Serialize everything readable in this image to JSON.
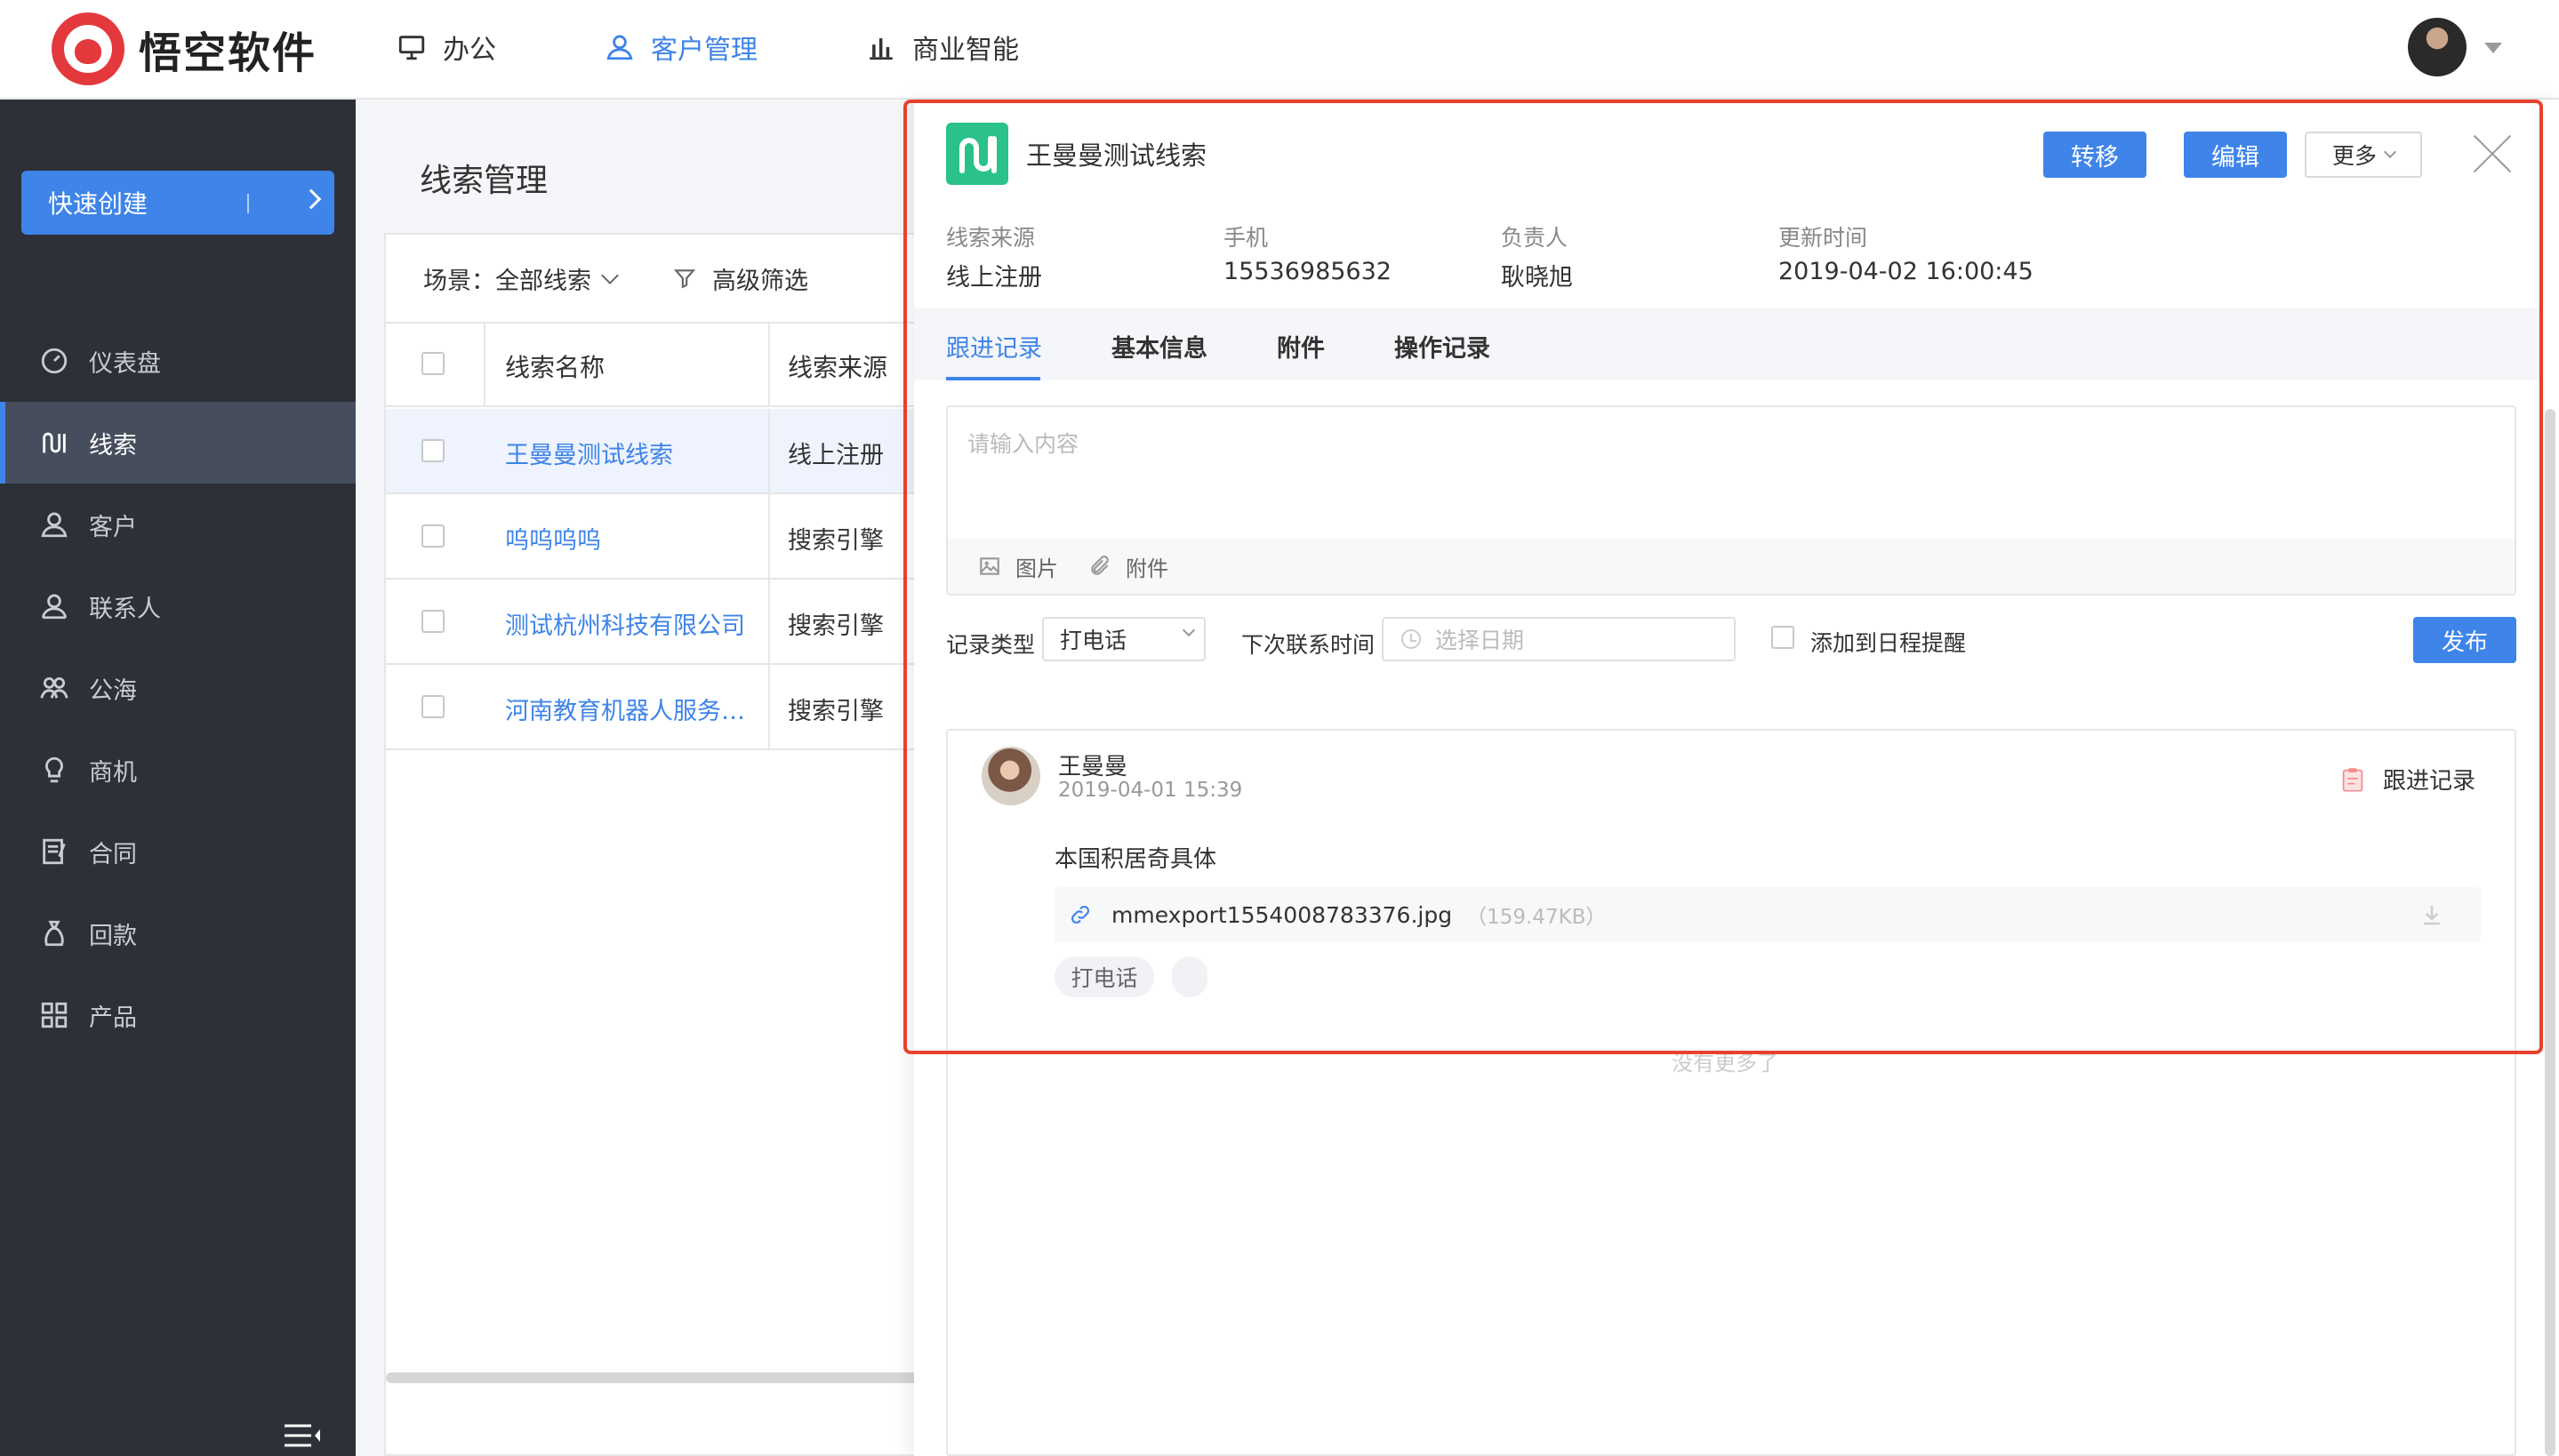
{
  "header": {
    "logo_text": "悟空软件",
    "nav": [
      {
        "label": "办公",
        "icon": "monitor-icon"
      },
      {
        "label": "客户管理",
        "icon": "user-icon",
        "active": true
      },
      {
        "label": "商业智能",
        "icon": "bar-chart-icon"
      }
    ]
  },
  "sidebar": {
    "quick_create": "快速创建",
    "items": [
      {
        "label": "仪表盘",
        "icon": "dashboard-icon"
      },
      {
        "label": "线索",
        "icon": "clue-icon",
        "active": true
      },
      {
        "label": "客户",
        "icon": "customer-icon"
      },
      {
        "label": "联系人",
        "icon": "contact-icon"
      },
      {
        "label": "公海",
        "icon": "public-pool-icon"
      },
      {
        "label": "商机",
        "icon": "bulb-icon"
      },
      {
        "label": "合同",
        "icon": "contract-icon"
      },
      {
        "label": "回款",
        "icon": "money-bag-icon"
      },
      {
        "label": "产品",
        "icon": "product-icon"
      }
    ]
  },
  "list": {
    "title": "线索管理",
    "scene_label": "场景：",
    "scene_value": "全部线索",
    "advanced_filter": "高级筛选",
    "columns": [
      "线索名称",
      "线索来源"
    ],
    "rows": [
      {
        "name": "王曼曼测试线索",
        "source": "线上注册"
      },
      {
        "name": "呜呜呜呜",
        "source": "搜索引擎"
      },
      {
        "name": "测试杭州科技有限公司",
        "source": "搜索引擎"
      },
      {
        "name": "河南教育机器人服务…",
        "source": "搜索引擎"
      }
    ]
  },
  "detail": {
    "title": "王曼曼测试线索",
    "buttons": {
      "transfer": "转移",
      "edit": "编辑",
      "more": "更多"
    },
    "info": [
      {
        "label": "线索来源",
        "value": "线上注册"
      },
      {
        "label": "手机",
        "value": "15536985632"
      },
      {
        "label": "负责人",
        "value": "耿晓旭"
      },
      {
        "label": "更新时间",
        "value": "2019-04-02 16:00:45"
      }
    ],
    "tabs": [
      "跟进记录",
      "基本信息",
      "附件",
      "操作记录"
    ],
    "editor": {
      "placeholder": "请输入内容",
      "image_tool": "图片",
      "attach_tool": "附件"
    },
    "form": {
      "record_type_label": "记录类型",
      "record_type_value": "打电话",
      "next_contact_label": "下次联系时间",
      "date_placeholder": "选择日期",
      "remind_label": "添加到日程提醒",
      "publish": "发布"
    },
    "record": {
      "author": "王曼曼",
      "time": "2019-04-01 15:39",
      "type_label": "跟进记录",
      "content": "本国积居奇具体",
      "attachment_name": "mmexport1554008783376.jpg",
      "attachment_size": "（159.47KB）",
      "tag": "打电话"
    },
    "no_more": "没有更多了"
  },
  "colors": {
    "accent": "#3e84e9",
    "sidebar_bg": "#2d3037",
    "clue_icon_bg": "#2ac28a",
    "highlight_frame": "#e8412d"
  }
}
